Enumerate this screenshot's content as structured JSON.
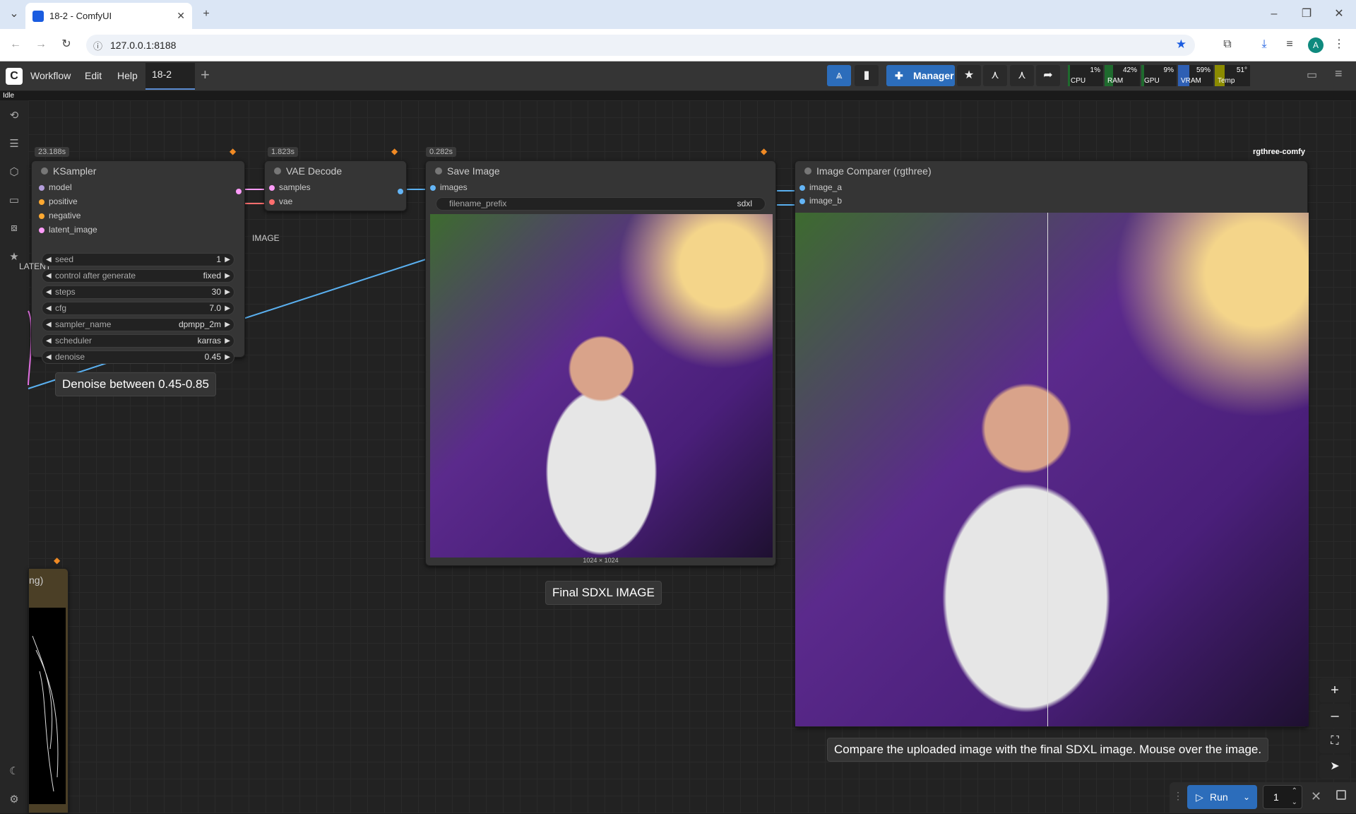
{
  "browser": {
    "tab_title": "18-2 - ComfyUI",
    "url": "127.0.0.1:8188",
    "profile_initial": "A"
  },
  "menu": {
    "items": [
      "Workflow",
      "Edit",
      "Help"
    ],
    "workflow_tab": "18-2",
    "manager_label": "Manager",
    "status": "Idle"
  },
  "monitors": [
    {
      "label": "CPU",
      "value": "1%",
      "level": 0.01,
      "color": "#1f6b2e"
    },
    {
      "label": "RAM",
      "value": "42%",
      "level": 0.42,
      "color": "#1f6b2e"
    },
    {
      "label": "GPU",
      "value": "9%",
      "level": 0.09,
      "color": "#1f6b2e"
    },
    {
      "label": "VRAM",
      "value": "59%",
      "level": 0.59,
      "color": "#2e5fb4"
    },
    {
      "label": "Temp",
      "value": "51°",
      "level": 0.51,
      "color": "#8b8b00"
    }
  ],
  "nodes": {
    "ksampler": {
      "timing": "23.188s",
      "title": "KSampler",
      "inputs": [
        "model",
        "positive",
        "negative",
        "latent_image"
      ],
      "output": "LATENT",
      "widgets": [
        {
          "label": "seed",
          "value": "1"
        },
        {
          "label": "control after generate",
          "value": "fixed"
        },
        {
          "label": "steps",
          "value": "30"
        },
        {
          "label": "cfg",
          "value": "7.0"
        },
        {
          "label": "sampler_name",
          "value": "dpmpp_2m"
        },
        {
          "label": "scheduler",
          "value": "karras"
        },
        {
          "label": "denoise",
          "value": "0.45"
        }
      ]
    },
    "vae_decode": {
      "timing": "1.823s",
      "title": "VAE Decode",
      "inputs": [
        "samples",
        "vae"
      ],
      "output": "IMAGE"
    },
    "save_image": {
      "timing": "0.282s",
      "title": "Save Image",
      "input": "images",
      "widget_label": "filename_prefix",
      "widget_value": "sdxl",
      "image_size": "1024 × 1024"
    },
    "image_comparer": {
      "title": "Image Comparer (rgthree)",
      "inputs": [
        "image_a",
        "image_b"
      ],
      "badge": "rgthree-comfy"
    },
    "partial_node": {
      "title_fragment": "ng)"
    }
  },
  "notes": {
    "denoise": "Denoise between 0.45-0.85",
    "final": "Final SDXL IMAGE",
    "compare": "Compare the uploaded image with the final SDXL image. Mouse over the image."
  },
  "run": {
    "label": "Run",
    "count": "1"
  },
  "colors": {
    "accent": "#2c6dbb",
    "link_blue": "#5ab0f0",
    "link_pink": "#e070e0",
    "slot_model": "#b39ddb",
    "slot_cond": "#ffa931",
    "slot_latent": "#ff9cf9",
    "slot_image": "#64b5f6",
    "slot_vae": "#ff6e6e"
  }
}
